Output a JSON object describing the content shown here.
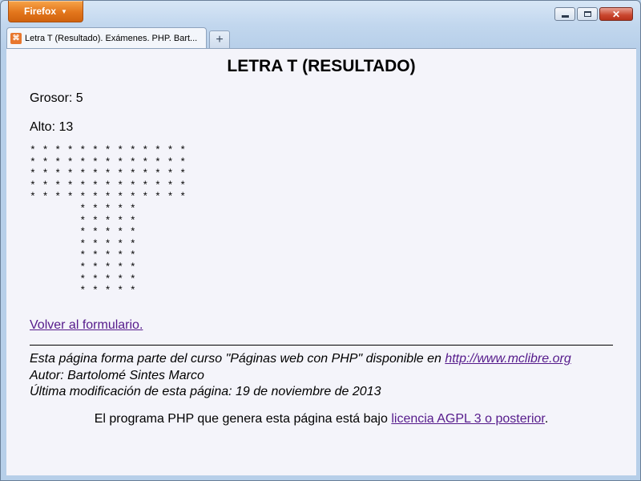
{
  "app": {
    "button_label": "Firefox",
    "caret": "▼"
  },
  "tabs": [
    {
      "icon_text": "⌘",
      "title": "Letra T (Resultado). Exámenes. PHP. Bart..."
    }
  ],
  "newtab_symbol": "+",
  "window_controls": {
    "close_symbol": "✕"
  },
  "page": {
    "title": "LETRA T (RESULTADO)",
    "grosor": "Grosor: 5",
    "alto": "Alto: 13",
    "letter_art": "* * * * * * * * * * * * *\n* * * * * * * * * * * * *\n* * * * * * * * * * * * *\n* * * * * * * * * * * * *\n* * * * * * * * * * * * *\n        * * * * *\n        * * * * *\n        * * * * *\n        * * * * *\n        * * * * *\n        * * * * *\n        * * * * *\n        * * * * *",
    "back_link": "Volver al formulario.",
    "footer_line1_text": "Esta página forma parte del curso \"Páginas web con PHP\" disponible en ",
    "footer_link": "http://www.mclibre.org",
    "footer_line2": "Autor: Bartolomé Sintes Marco",
    "footer_line3": "Última modificación de esta página: 19 de noviembre de 2013",
    "license_text": "El programa PHP que genera esta página está bajo ",
    "license_link": "licencia AGPL 3 o posterior",
    "license_end": "."
  }
}
